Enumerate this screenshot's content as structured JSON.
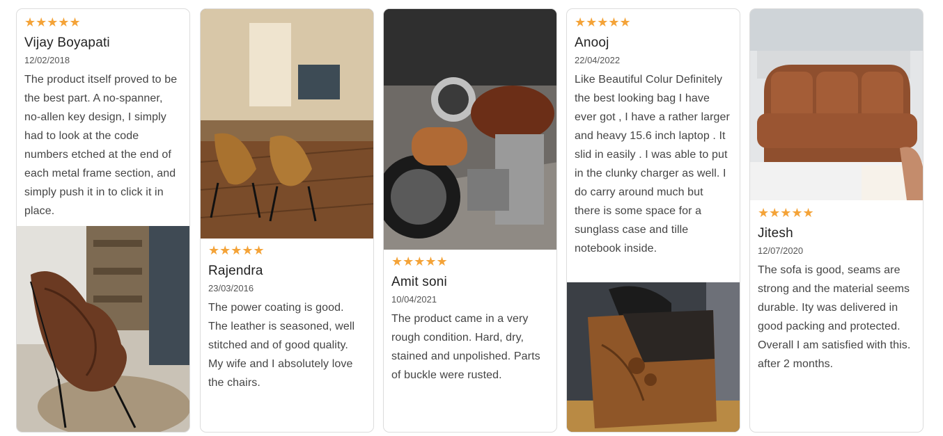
{
  "star_color": "#f4a338",
  "reviews": [
    {
      "stars": "★★★★★",
      "rating": 5,
      "name": "Vijay Boyapati",
      "date": "12/02/2018",
      "text": "The product itself proved to be the best part. A no-spanner, no-allen key design, I simply had to look at the code numbers etched at the end of each metal frame section, and simply push it in to click it in place."
    },
    {
      "stars": "★★★★★",
      "rating": 5,
      "name": "Rajendra",
      "date": "23/03/2016",
      "text": "The power coating is good. The leather is seasoned, well stitched and of good quality. My wife and I absolutely love the chairs."
    },
    {
      "stars": "★★★★★",
      "rating": 5,
      "name": "Amit soni",
      "date": "10/04/2021",
      "text": "The product came in a very rough condition. Hard, dry, stained and unpolished. Parts of buckle were rusted."
    },
    {
      "stars": "★★★★★",
      "rating": 5,
      "name": "Anooj",
      "date": "22/04/2022",
      "text": "Like Beautiful Colur Definitely the best looking bag I have ever got , I have a rather larger and heavy 15.6 inch laptop . It slid in easily . I was able to put in the clunky charger as well. I do carry around much but there is some space for a sunglass case and tille notebook inside."
    },
    {
      "stars": "★★★★★",
      "rating": 5,
      "name": "Jitesh",
      "date": "12/07/2020",
      "text": "The sofa is good, seams are strong and the material seems durable. Ity was delivered in good packing and protected. Overall I am satisfied with this. after 2 months."
    }
  ]
}
